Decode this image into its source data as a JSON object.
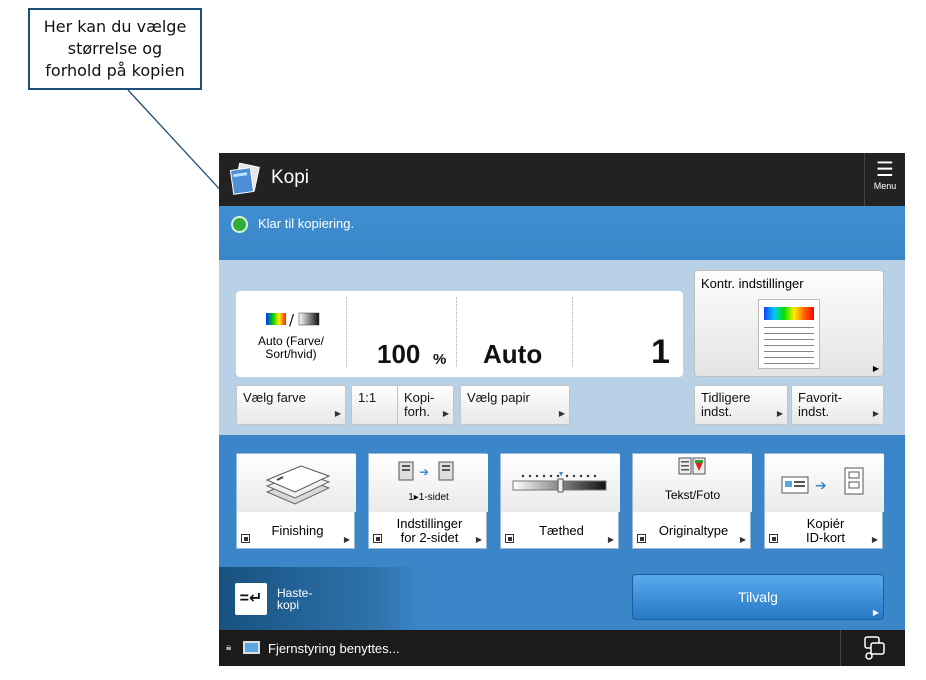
{
  "callout": {
    "lines": [
      "Her kan du vælge",
      "størrelse og",
      "forhold på kopien"
    ]
  },
  "titlebar": {
    "title": "Kopi",
    "menu_label": "Menu"
  },
  "status": {
    "message": "Klar til kopiering."
  },
  "summary": {
    "color_mode": [
      "Auto (Farve/",
      "Sort/hvid)"
    ],
    "ratio_value": "100",
    "ratio_unit": "%",
    "paper": "Auto",
    "copies": "1"
  },
  "buttons": {
    "choose_color": "Vælg farve",
    "one_to_one": "1:1",
    "copy_ratio": [
      "Kopi-",
      "forh."
    ],
    "choose_paper": "Vælg papir",
    "check_settings": "Kontr. indstillinger",
    "previous": [
      "Tidligere",
      "indst."
    ],
    "favorites": [
      "Favorit-",
      "indst."
    ]
  },
  "functions": [
    {
      "label": [
        "Finishing"
      ],
      "icon": "finishing-icon"
    },
    {
      "label": [
        "Indstillinger",
        "for 2-sidet"
      ],
      "icon": "two-sided-icon",
      "sub": "1▸1-sidet"
    },
    {
      "label": [
        "Tæthed"
      ],
      "icon": "density-slider-icon"
    },
    {
      "label": [
        "Originaltype"
      ],
      "icon": "original-type-icon",
      "sub": "Tekst/Foto"
    },
    {
      "label": [
        "Kopiér",
        "ID-kort"
      ],
      "icon": "id-card-icon"
    }
  ],
  "lower": {
    "express_copy": [
      "Haste-",
      "kopi"
    ],
    "options": "Tilvalg"
  },
  "footer": {
    "text": "Fjernstyring benyttes..."
  },
  "colors": {
    "status_bar": "#3b86c8",
    "title_bar": "#222222",
    "main_panel": "#b9d1e7",
    "status_ok": "#2fae3a"
  }
}
